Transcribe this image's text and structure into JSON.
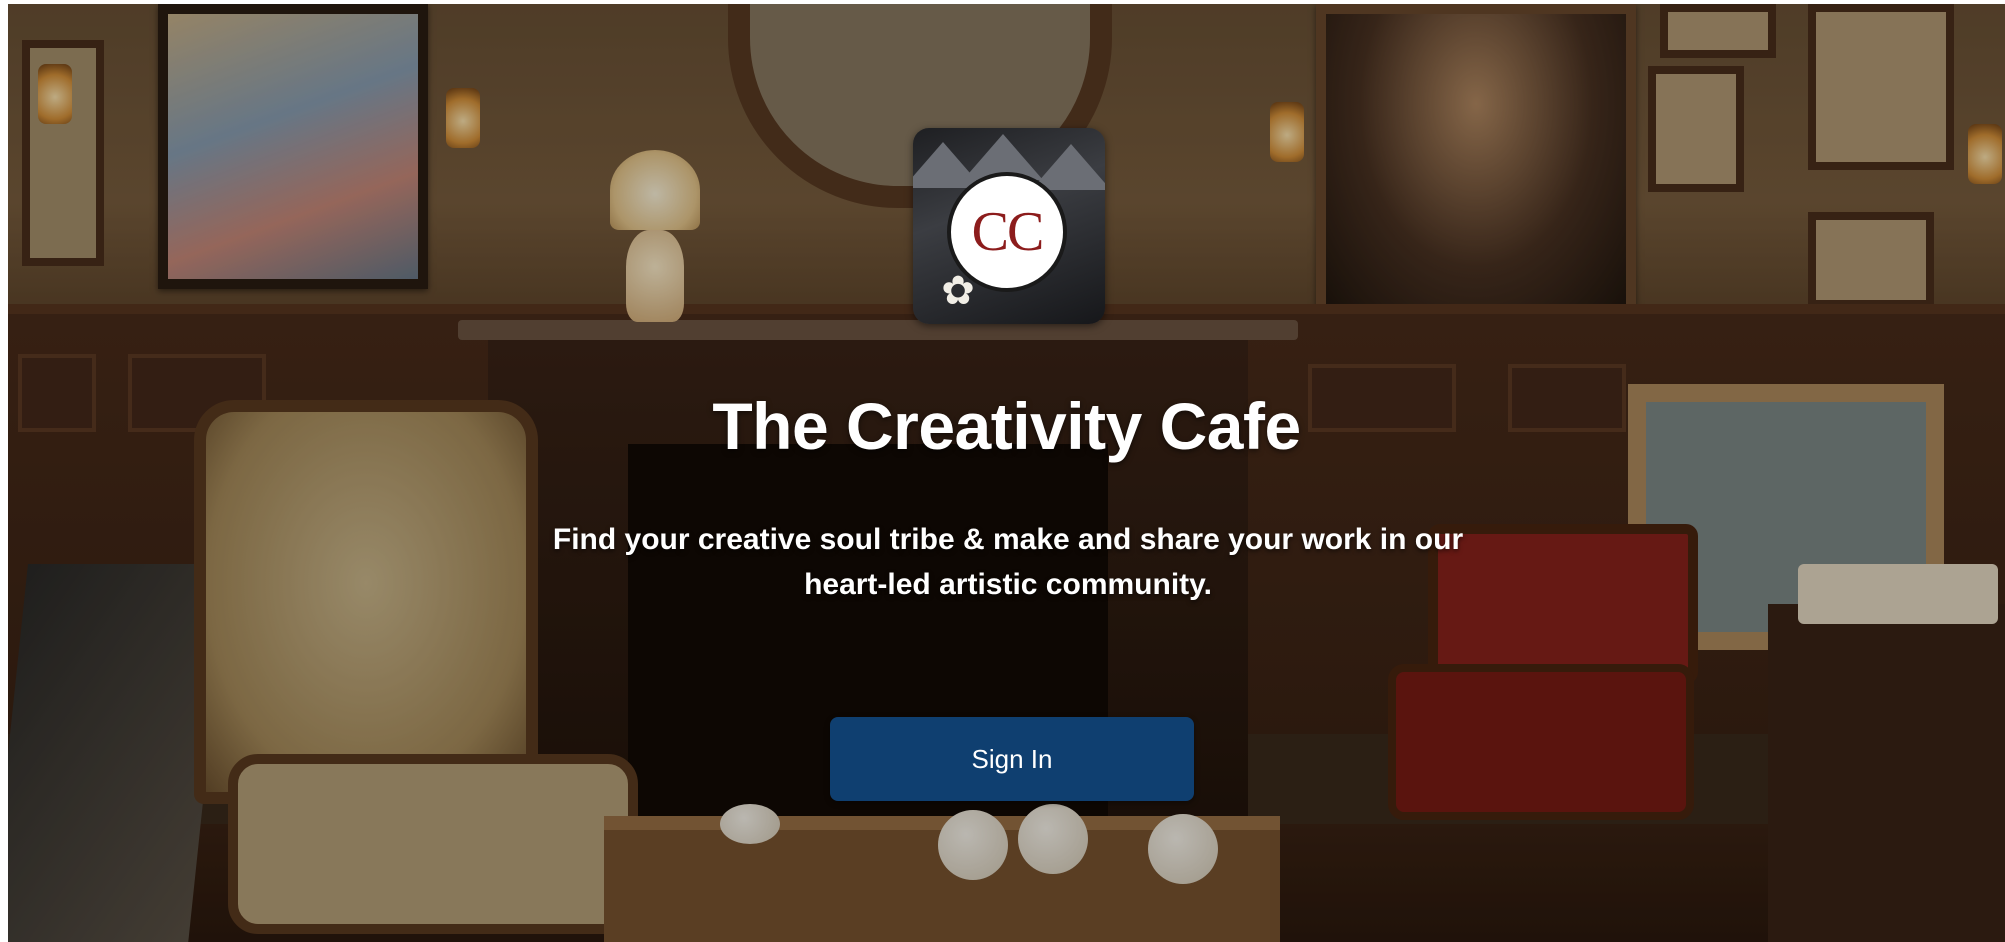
{
  "hero": {
    "logo_text": "CC",
    "title": "The Creativity Cafe",
    "subtitle_line1": "Find your creative soul tribe & make and share your work in our",
    "subtitle_line2": "heart-led artistic community.",
    "signin_label": "Sign In"
  },
  "colors": {
    "button_bg": "#0f3f70",
    "logo_text": "#8c1c1c",
    "text": "#ffffff"
  },
  "icons": {
    "logo_flower": "flower-icon"
  }
}
